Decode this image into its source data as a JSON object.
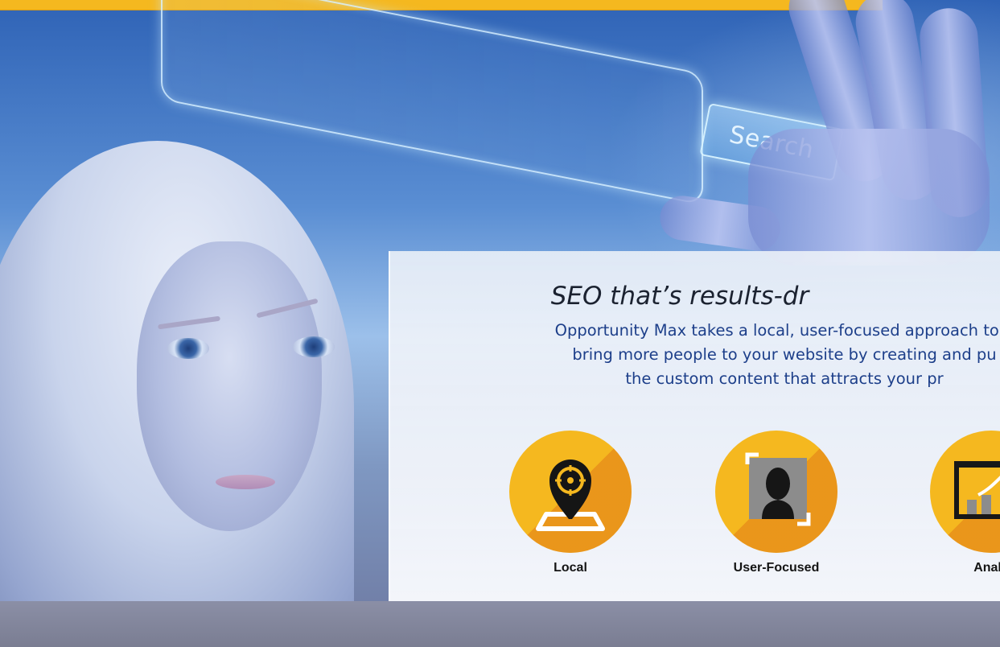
{
  "hero": {
    "search_label": "Search",
    "heading": "SEO that’s results-dr",
    "paragraph_line1": "Opportunity Max takes a local, user-focused approach to S",
    "paragraph_line2": "bring more people to your website by creating and pu",
    "paragraph_line3": "the custom content that attracts your pr"
  },
  "features": [
    {
      "label": "Local",
      "icon": "map-pin-icon"
    },
    {
      "label": "User-Focused",
      "icon": "user-profile-icon"
    },
    {
      "label": "Analy",
      "icon": "analytics-chart-icon"
    }
  ],
  "colors": {
    "accent": "#f5b81f",
    "accent_shadow": "#e07a18",
    "heading_text": "#1b2230",
    "body_text": "#1d3f8a"
  }
}
